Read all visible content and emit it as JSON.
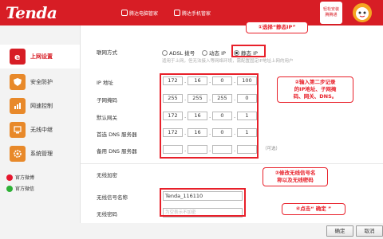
{
  "brand": {
    "logo": "Tenda"
  },
  "header": {
    "links": [
      {
        "label": "腾达电脑管家",
        "icon": "shield-icon"
      },
      {
        "label": "腾达手机管家",
        "icon": "phone-icon"
      }
    ],
    "qr_label": "轻松安装\n腾腾通"
  },
  "sidebar": {
    "items": [
      {
        "label": "上网设置",
        "icon": "e-globe-icon",
        "active": true
      },
      {
        "label": "安全防护",
        "icon": "shield-icon",
        "active": false
      },
      {
        "label": "网速控制",
        "icon": "speed-icon",
        "active": false
      },
      {
        "label": "无线中继",
        "icon": "wifi-relay-icon",
        "active": false
      },
      {
        "label": "系统管理",
        "icon": "gear-icon",
        "active": false
      }
    ],
    "social": [
      {
        "label": "官方微博",
        "icon": "weibo-icon",
        "color": "#e6162d"
      },
      {
        "label": "官方微信",
        "icon": "wechat-icon",
        "color": "#2eb136"
      }
    ]
  },
  "wan": {
    "label": "联网方式",
    "options": [
      "ADSL 拨号",
      "动态 IP",
      "静态 IP"
    ],
    "selected": "静态 IP",
    "hint": "适用于上网，但无法接入等网络环境，需配置固定IP地址上网的用户"
  },
  "fields": {
    "ip": {
      "label": "IP 地址",
      "values": [
        "172",
        "16",
        "0",
        "100"
      ]
    },
    "mask": {
      "label": "子网掩码",
      "values": [
        "255",
        "255",
        "255",
        "0"
      ]
    },
    "gateway": {
      "label": "默认网关",
      "values": [
        "172",
        "16",
        "0",
        "1"
      ]
    },
    "dns1": {
      "label": "首选 DNS 服务器",
      "values": [
        "172",
        "16",
        "0",
        "1"
      ]
    },
    "dns2": {
      "label": "备用 DNS 服务器",
      "values": [
        "",
        "",
        "",
        ""
      ]
    },
    "optional": "（可选）"
  },
  "wireless": {
    "section": "无线加密",
    "ssid_label": "无线信号名称",
    "ssid_value": "Tenda_116110",
    "pwd_label": "无线密码",
    "pwd_placeholder": "为空表示不加密"
  },
  "callouts": {
    "c1": "①选择“静态IP”",
    "c2": "②输入第二步记录\n的IP地址、子网掩\n码、网关、DNS。",
    "c3": "③修改无线信号名\n称以及无线密码",
    "c4": "④点击“ 确定 ”"
  },
  "buttons": {
    "ok": "确定",
    "cancel": "取消"
  },
  "colors": {
    "brand_red": "#d71d25",
    "callout_red": "#e8202a"
  }
}
